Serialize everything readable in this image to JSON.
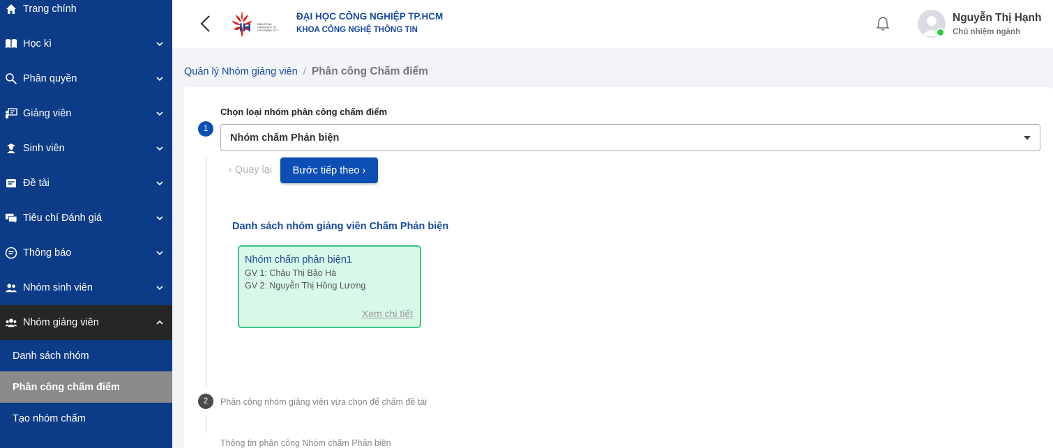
{
  "sidebar": {
    "items": [
      {
        "label": "Trang chính",
        "icon": "home-icon"
      },
      {
        "label": "Học kì",
        "icon": "book-icon"
      },
      {
        "label": "Phân quyền",
        "icon": "key-search-icon"
      },
      {
        "label": "Giảng viên",
        "icon": "teacher-board-icon"
      },
      {
        "label": "Sinh viên",
        "icon": "student-icon"
      },
      {
        "label": "Đề tài",
        "icon": "topic-card-icon"
      },
      {
        "label": "Tiêu chí Đánh giá",
        "icon": "chat-icon"
      },
      {
        "label": "Thông báo",
        "icon": "message-icon"
      },
      {
        "label": "Nhóm sinh viên",
        "icon": "users-icon"
      },
      {
        "label": "Nhóm giảng viên",
        "icon": "group-icon"
      }
    ],
    "sub_items": [
      {
        "label": "Danh sách nhóm"
      },
      {
        "label": "Phân công chấm điểm"
      },
      {
        "label": "Tạo nhóm chấm"
      }
    ]
  },
  "header": {
    "logo_text": "IH",
    "logo_small_text": "INDUSTRIAL UNIVERSITY OF HOCHIMINH CITY",
    "university": "ĐẠI HỌC CÔNG NGHIỆP TP.HCM",
    "faculty": "KHOA CÔNG NGHỆ THÔNG TIN",
    "user_name": "Nguyễn Thị Hạnh",
    "user_role": "Chủ nhiệm ngành"
  },
  "breadcrumb": {
    "parent": "Quản lý Nhóm giảng viên",
    "separator": "/",
    "current": "Phân công Chấm điểm"
  },
  "step1": {
    "number": "1",
    "label": "Chọn loại nhóm phân công chấm điểm",
    "selected": "Nhóm chấm Phản biện",
    "prev_label": "Quay lại",
    "next_label": "Bước tiếp theo"
  },
  "group_list": {
    "title": "Danh sách nhóm giảng viên Chấm Phản biện",
    "groups": [
      {
        "name": "Nhóm chấm phản biện1",
        "gv1": "GV 1: Châu Thị Bảo Hà",
        "gv2": "GV 2: Nguyễn Thị Hồng Lương",
        "detail": "Xem chi tiết"
      }
    ]
  },
  "step2": {
    "number": "2",
    "label": "Phân công nhóm giảng viên vừa chọn để chấm đề tài"
  },
  "step3": {
    "label": "Thông tin phân công Nhóm chấm Phản biện"
  },
  "colors": {
    "sidebar_bg": "#0c3b87",
    "primary": "#0c4fb4",
    "active_bg": "#262626",
    "current_sub_bg": "#8a8a8a",
    "card_green": "#d8f9e8",
    "card_border": "#3ec486",
    "online": "#2ecc40"
  }
}
